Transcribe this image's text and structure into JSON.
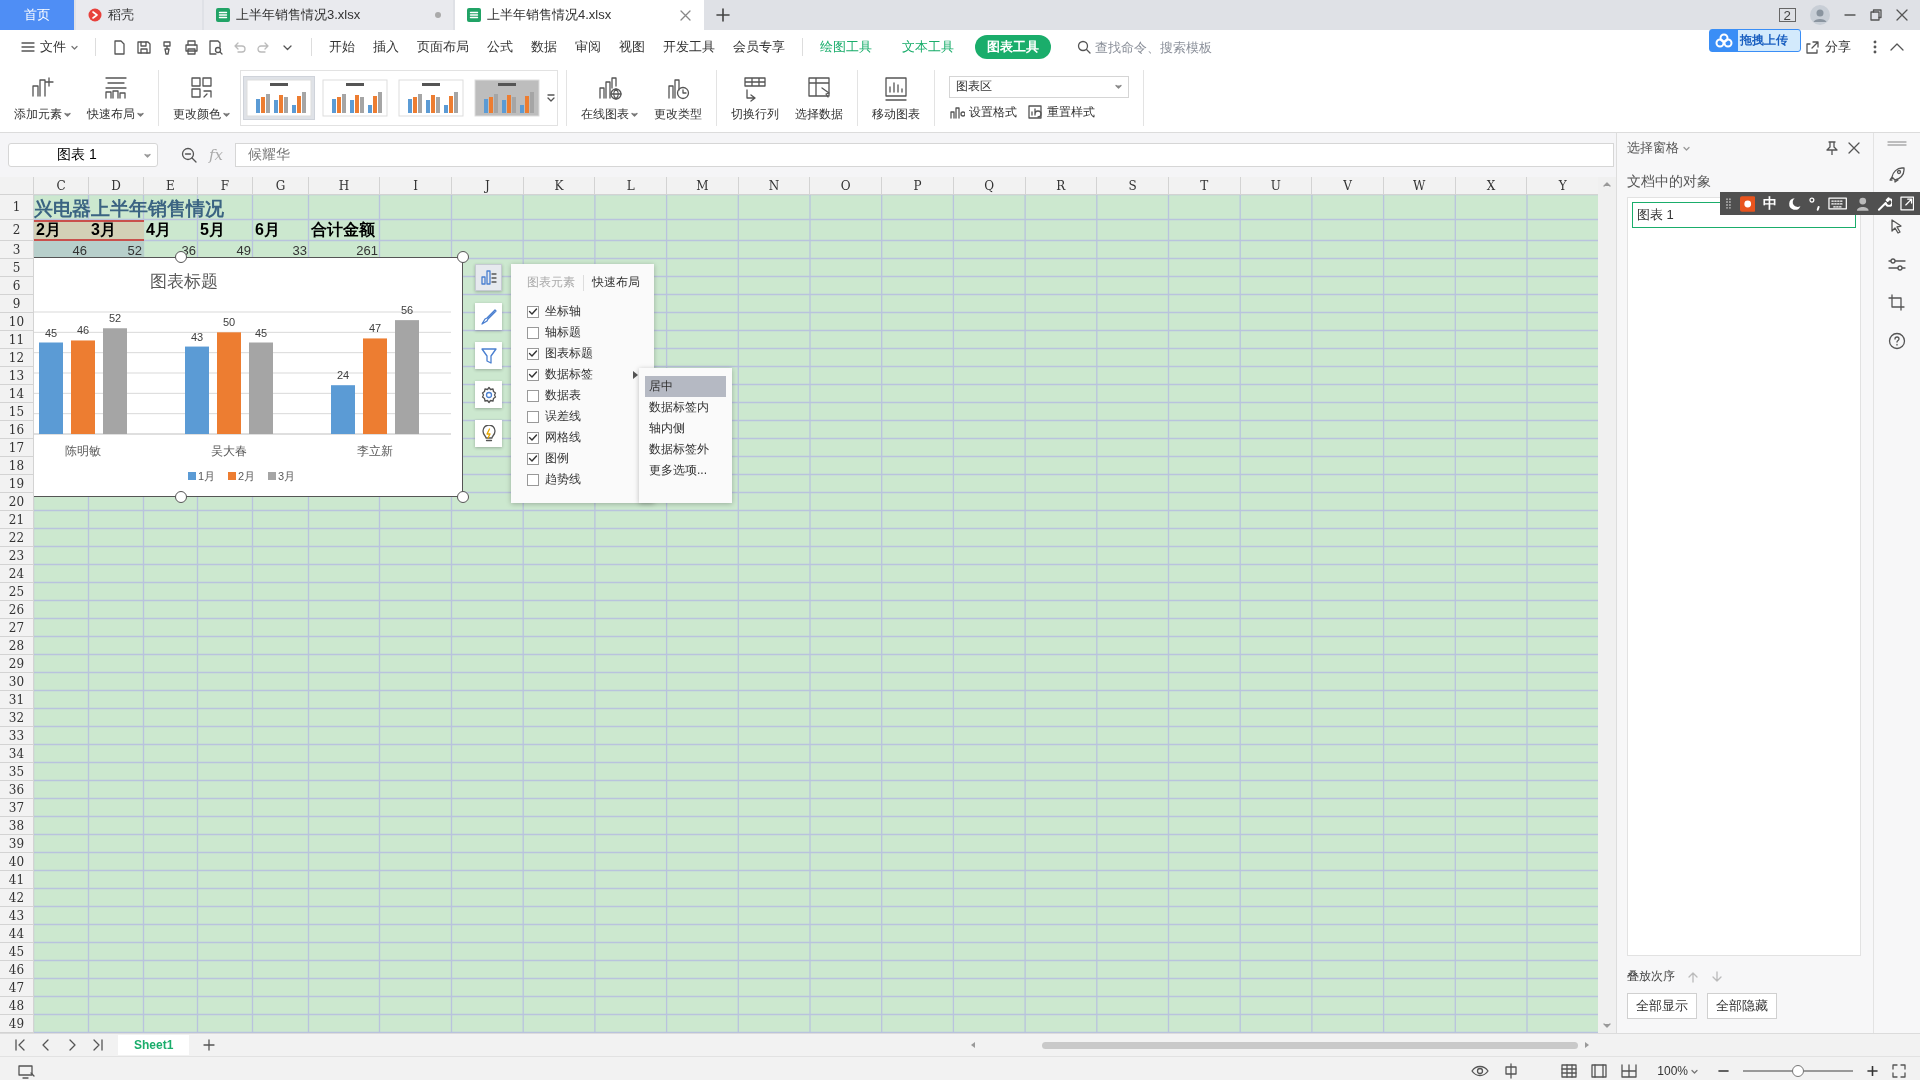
{
  "tabs": [
    {
      "label": "首页",
      "kind": "home",
      "selected": false,
      "modified": false
    },
    {
      "label": "稻壳",
      "kind": "docer",
      "selected": false,
      "modified": false
    },
    {
      "label": "上半年销售情况3.xlsx",
      "kind": "sheet",
      "selected": false,
      "modified": true
    },
    {
      "label": "上半年销售情况4.xlsx",
      "kind": "sheet",
      "selected": true,
      "modified": false
    }
  ],
  "window_count": "2",
  "menu": {
    "file_label": "文件",
    "items": [
      {
        "label": "开始",
        "selected": false
      },
      {
        "label": "插入",
        "selected": false
      },
      {
        "label": "页面布局",
        "selected": false
      },
      {
        "label": "公式",
        "selected": false
      },
      {
        "label": "数据",
        "selected": false
      },
      {
        "label": "审阅",
        "selected": false
      },
      {
        "label": "视图",
        "selected": false
      },
      {
        "label": "开发工具",
        "selected": false
      },
      {
        "label": "会员专享",
        "selected": false
      }
    ],
    "context_tabs": [
      {
        "label": "绘图工具",
        "selected": false
      },
      {
        "label": "文本工具",
        "selected": false
      },
      {
        "label": "图表工具",
        "selected": true
      }
    ],
    "search": {
      "placeholder": "查找命令、搜索模板"
    },
    "share": "分享",
    "upload_hint": "拖拽上传"
  },
  "ribbon": {
    "buttons": [
      {
        "label": "添加元素",
        "dropdown": true
      },
      {
        "label": "快速布局",
        "dropdown": true
      },
      {
        "label": "更改颜色",
        "dropdown": true
      }
    ],
    "chart_styles": [
      {
        "selected": true
      },
      {
        "selected": false
      },
      {
        "selected": false
      },
      {
        "selected": false
      }
    ],
    "buttons_2": [
      {
        "label": "在线图表",
        "dropdown": true
      },
      {
        "label": "更改类型",
        "dropdown": false
      },
      {
        "label": "切换行列",
        "dropdown": false
      },
      {
        "label": "选择数据",
        "dropdown": false
      },
      {
        "label": "移动图表",
        "dropdown": false
      }
    ],
    "element_select": {
      "value": "图表区"
    },
    "format_buttons": [
      "设置格式",
      "重置样式"
    ]
  },
  "formula_bar": {
    "name_box": "图表 1",
    "fx": "fx",
    "value": "候耀华"
  },
  "columns": [
    "C",
    "D",
    "E",
    "F",
    "G",
    "H",
    "I",
    "J",
    "K",
    "L",
    "M",
    "N",
    "O",
    "P",
    "Q",
    "R",
    "S",
    "T",
    "U",
    "V",
    "W",
    "X",
    "Y"
  ],
  "rows": [
    {
      "number": "1",
      "kind": "title",
      "cells": [
        {
          "text": "兴电器上半年销售情况",
          "selected": false
        }
      ]
    },
    {
      "number": "2",
      "kind": "header",
      "cells": [
        {
          "text": "2月",
          "selected": true
        },
        {
          "text": "3月",
          "selected": true
        },
        {
          "text": "4月",
          "selected": false
        },
        {
          "text": "5月",
          "selected": false
        },
        {
          "text": "6月",
          "selected": false
        },
        {
          "text": "合计金额",
          "selected": false
        }
      ]
    },
    {
      "number": "3",
      "kind": "data",
      "cells": [
        {
          "text": "46",
          "selected": true
        },
        {
          "text": "52",
          "selected": true
        },
        {
          "text": "36",
          "selected": false
        },
        {
          "text": "49",
          "selected": false
        },
        {
          "text": "33",
          "selected": false
        },
        {
          "text": "261",
          "selected": false
        }
      ]
    },
    {
      "number": "5"
    },
    {
      "number": "6"
    },
    {
      "number": "9"
    },
    {
      "number": "10"
    },
    {
      "number": "11"
    },
    {
      "number": "12"
    },
    {
      "number": "13"
    },
    {
      "number": "14"
    },
    {
      "number": "15"
    },
    {
      "number": "16"
    },
    {
      "number": "17"
    },
    {
      "number": "18"
    },
    {
      "number": "19"
    },
    {
      "number": "20"
    },
    {
      "number": "21"
    },
    {
      "number": "22"
    },
    {
      "number": "23"
    },
    {
      "number": "24"
    },
    {
      "number": "25"
    },
    {
      "number": "26"
    },
    {
      "number": "27"
    },
    {
      "number": "28"
    },
    {
      "number": "29"
    },
    {
      "number": "30"
    },
    {
      "number": "31"
    },
    {
      "number": "32"
    },
    {
      "number": "33"
    },
    {
      "number": "34"
    },
    {
      "number": "35"
    },
    {
      "number": "36"
    },
    {
      "number": "37"
    },
    {
      "number": "38"
    },
    {
      "number": "39"
    },
    {
      "number": "40"
    },
    {
      "number": "41"
    },
    {
      "number": "42"
    },
    {
      "number": "43"
    },
    {
      "number": "44"
    },
    {
      "number": "45"
    },
    {
      "number": "46"
    },
    {
      "number": "47"
    },
    {
      "number": "48"
    },
    {
      "number": "49"
    }
  ],
  "chart": {
    "chart_data": {
      "type": "bar",
      "title": "图表标题",
      "categories": [
        "陈明敏",
        "吴大春",
        "李立新"
      ],
      "series": [
        {
          "name": "1月",
          "color": "#5b9bd5",
          "values": [
            45,
            43,
            24
          ]
        },
        {
          "name": "2月",
          "color": "#ed7d31",
          "values": [
            46,
            50,
            47
          ]
        },
        {
          "name": "3月",
          "color": "#a5a5a5",
          "values": [
            52,
            45,
            56
          ]
        }
      ],
      "data_labels": true,
      "legend": "bottom"
    }
  },
  "chart_tools": [
    {
      "kind": "elements",
      "selected": true
    },
    {
      "kind": "style",
      "selected": false
    },
    {
      "kind": "filter",
      "selected": false
    },
    {
      "kind": "settings",
      "selected": false
    },
    {
      "kind": "ideas",
      "selected": false
    }
  ],
  "elements_popup": {
    "tabs": [
      {
        "label": "图表元素",
        "selected": false
      },
      {
        "label": "快速布局",
        "selected": true
      }
    ],
    "options": [
      {
        "label": "坐标轴",
        "checked": true,
        "submenu": false
      },
      {
        "label": "轴标题",
        "checked": false,
        "submenu": false
      },
      {
        "label": "图表标题",
        "checked": true,
        "submenu": false
      },
      {
        "label": "数据标签",
        "checked": true,
        "submenu": true
      },
      {
        "label": "数据表",
        "checked": false,
        "submenu": false
      },
      {
        "label": "误差线",
        "checked": false,
        "submenu": false
      },
      {
        "label": "网格线",
        "checked": true,
        "submenu": false
      },
      {
        "label": "图例",
        "checked": true,
        "submenu": false
      },
      {
        "label": "趋势线",
        "checked": false,
        "submenu": false
      }
    ],
    "submenu": [
      {
        "label": "居中",
        "selected": true
      },
      {
        "label": "数据标签内",
        "selected": false
      },
      {
        "label": "轴内侧",
        "selected": false
      },
      {
        "label": "数据标签外",
        "selected": false
      },
      {
        "label": "更多选项...",
        "selected": false
      }
    ]
  },
  "selection_pane": {
    "title": "选择窗格",
    "heading": "文档中的对象",
    "objects": [
      {
        "label": "图表 1",
        "selected": true
      }
    ],
    "order_label": "叠放次序",
    "buttons": [
      "全部显示",
      "全部隐藏"
    ]
  },
  "ime": {
    "mode": "中"
  },
  "sheets": [
    {
      "label": "Sheet1",
      "selected": true
    }
  ],
  "status_bar": {
    "zoom": "100%",
    "level": 0.5
  }
}
